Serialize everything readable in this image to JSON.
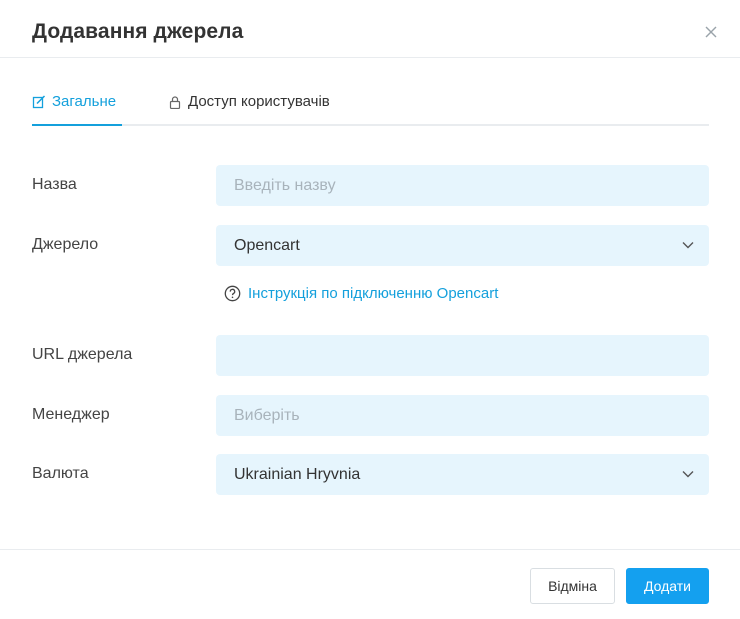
{
  "dialog": {
    "title": "Додавання джерела",
    "close_icon": "close-icon"
  },
  "tabs": [
    {
      "label": "Загальне",
      "icon": "edit-icon",
      "active": true
    },
    {
      "label": "Доступ користувачів",
      "icon": "lock-icon",
      "active": false
    }
  ],
  "form": {
    "name": {
      "label": "Назва",
      "placeholder": "Введіть назву",
      "value": ""
    },
    "source": {
      "label": "Джерело",
      "value": "Opencart"
    },
    "help_link": {
      "icon": "help-circle-icon",
      "text": "Інструкція по підключенню Opencart"
    },
    "url": {
      "label": "URL джерела",
      "value": ""
    },
    "manager": {
      "label": "Менеджер",
      "placeholder": "Виберіть"
    },
    "currency": {
      "label": "Валюта",
      "value": "Ukrainian Hryvnia"
    }
  },
  "footer": {
    "cancel_label": "Відміна",
    "add_label": "Додати"
  },
  "colors": {
    "accent": "#14a0dc",
    "field_bg": "#e6f5fd",
    "primary_button": "#14a0ef"
  }
}
